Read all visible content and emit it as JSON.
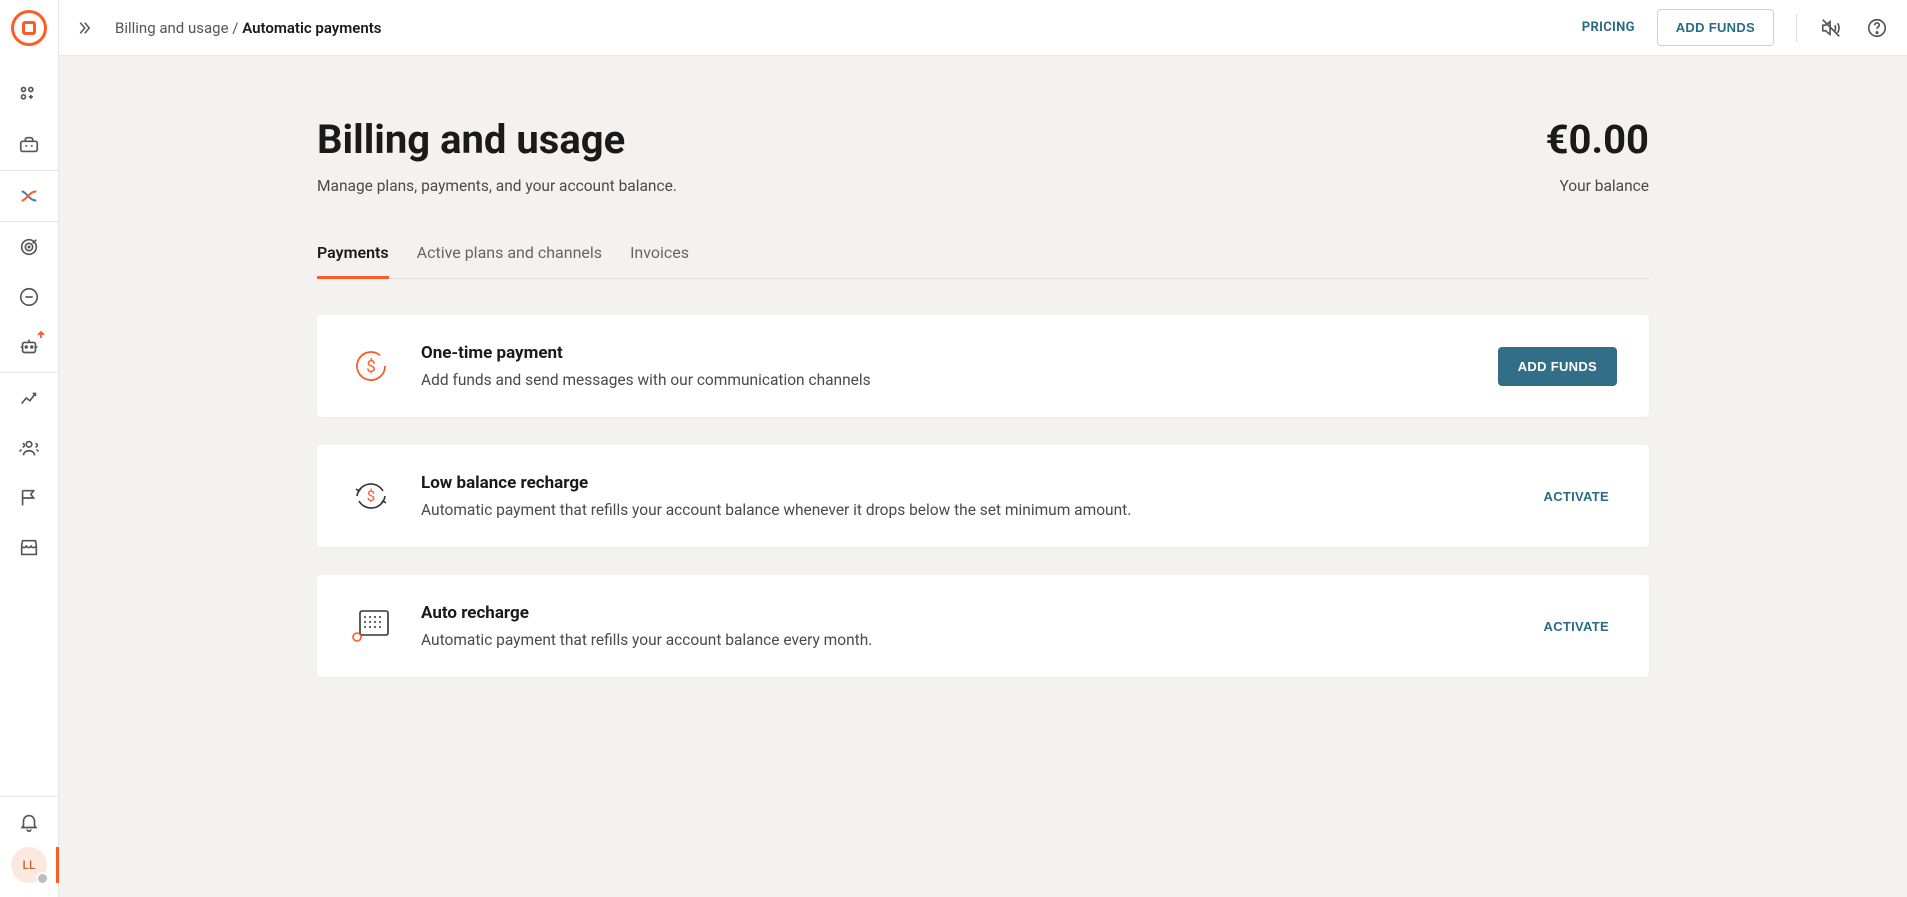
{
  "breadcrumb": {
    "parent": "Billing and usage",
    "separator": " / ",
    "current": "Automatic payments"
  },
  "topbar": {
    "pricing_label": "PRICING",
    "add_funds_label": "ADD FUNDS"
  },
  "page": {
    "title": "Billing and usage",
    "subtitle": "Manage plans, payments, and your account balance."
  },
  "balance": {
    "amount": "€0.00",
    "label": "Your balance"
  },
  "tabs": [
    {
      "label": "Payments",
      "active": true
    },
    {
      "label": "Active plans and channels",
      "active": false
    },
    {
      "label": "Invoices",
      "active": false
    }
  ],
  "cards": {
    "one_time": {
      "title": "One-time payment",
      "desc": "Add funds and send messages with our communication channels",
      "action": "ADD FUNDS"
    },
    "low_balance": {
      "title": "Low balance recharge",
      "desc": "Automatic payment that refills your account balance whenever it drops below the set minimum amount.",
      "action": "ACTIVATE"
    },
    "auto_recharge": {
      "title": "Auto recharge",
      "desc": "Automatic payment that refills your account balance every month.",
      "action": "ACTIVATE"
    }
  },
  "user": {
    "initials": "LL"
  }
}
